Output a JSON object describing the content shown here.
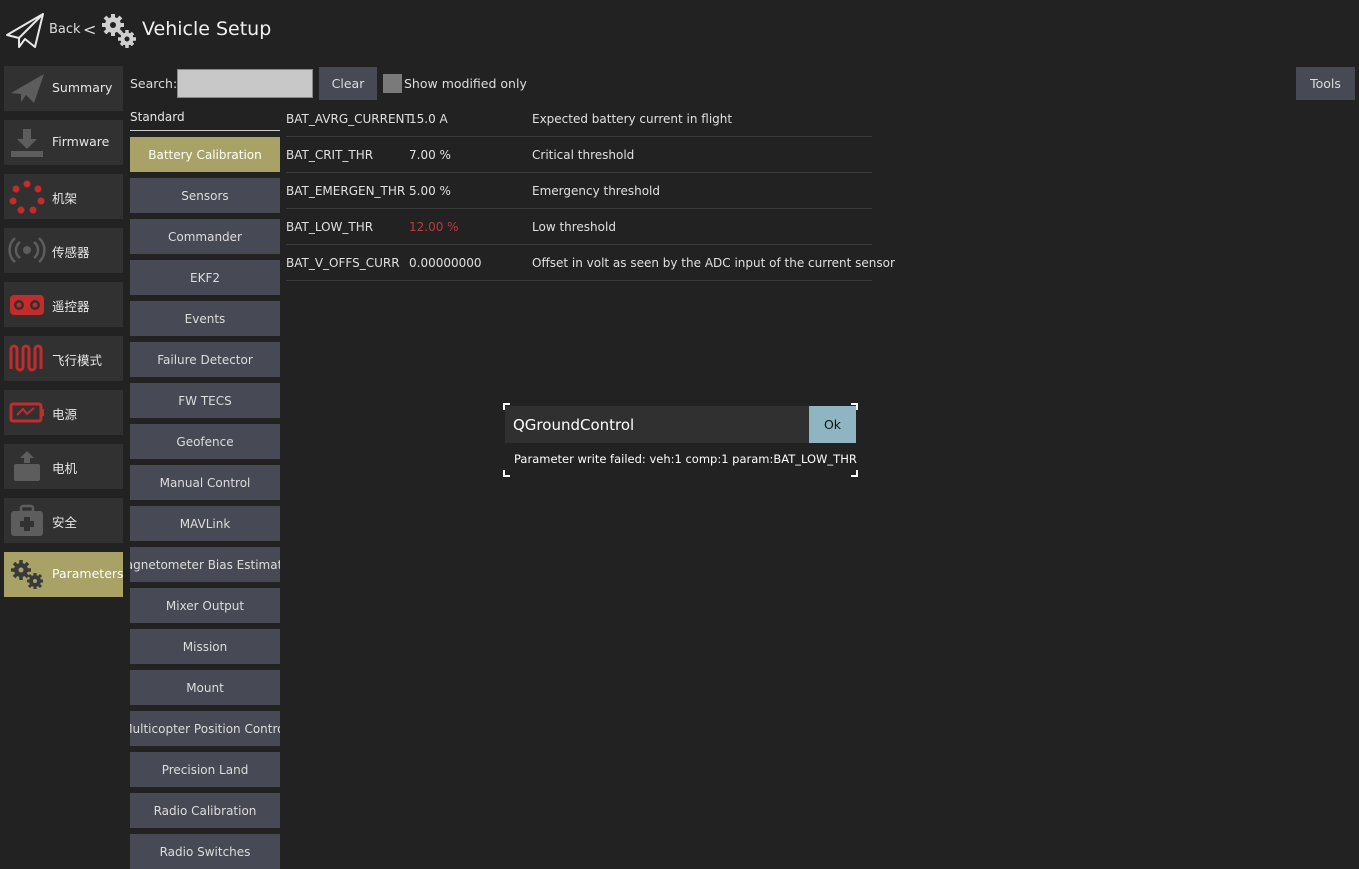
{
  "header": {
    "back_label": "Back",
    "separator": "<",
    "title": "Vehicle Setup"
  },
  "nav": {
    "items": [
      {
        "label": "Summary",
        "icon": "paper-plane-icon"
      },
      {
        "label": "Firmware",
        "icon": "download-icon"
      },
      {
        "label": "机架",
        "icon": "airframe-icon"
      },
      {
        "label": "传感器",
        "icon": "sensors-icon"
      },
      {
        "label": "遥控器",
        "icon": "radio-icon"
      },
      {
        "label": "飞行模式",
        "icon": "flight-modes-icon"
      },
      {
        "label": "电源",
        "icon": "battery-icon"
      },
      {
        "label": "电机",
        "icon": "motor-icon"
      },
      {
        "label": "安全",
        "icon": "safety-icon"
      },
      {
        "label": "Parameters",
        "icon": "gears-icon"
      }
    ],
    "active_index": 9
  },
  "search": {
    "label": "Search:",
    "value": "",
    "clear_label": "Clear",
    "modified_only_label": "Show modified only",
    "tools_label": "Tools"
  },
  "groups": {
    "heading": "Standard",
    "active_index": 0,
    "items": [
      "Battery Calibration",
      "Sensors",
      "Commander",
      "EKF2",
      "Events",
      "Failure Detector",
      "FW TECS",
      "Geofence",
      "Manual Control",
      "MAVLink",
      "Magnetometer Bias Estimator",
      "Mixer Output",
      "Mission",
      "Mount",
      "Multicopter Position Control",
      "Precision Land",
      "Radio Calibration",
      "Radio Switches"
    ]
  },
  "params": [
    {
      "name": "BAT_AVRG_CURRENT",
      "value": "15.0 A",
      "description": "Expected battery current in flight",
      "modified": false
    },
    {
      "name": "BAT_CRIT_THR",
      "value": "7.00 %",
      "description": "Critical threshold",
      "modified": false
    },
    {
      "name": "BAT_EMERGEN_THR",
      "value": "5.00 %",
      "description": "Emergency threshold",
      "modified": false
    },
    {
      "name": "BAT_LOW_THR",
      "value": "12.00 %",
      "description": "Low threshold",
      "modified": true
    },
    {
      "name": "BAT_V_OFFS_CURR",
      "value": "0.00000000",
      "description": "Offset in volt as seen by the ADC input of the current sensor",
      "modified": false
    }
  ],
  "dialog": {
    "title": "QGroundControl",
    "ok_label": "Ok",
    "message": "Parameter write failed: veh:1 comp:1 param:BAT_LOW_THR"
  },
  "colors": {
    "background": "#222222",
    "button": "#474954",
    "active": "#a8a267",
    "modified_value": "#c0393a",
    "ok_button": "#8fb4c2",
    "icon_red": "#c42b2b"
  }
}
